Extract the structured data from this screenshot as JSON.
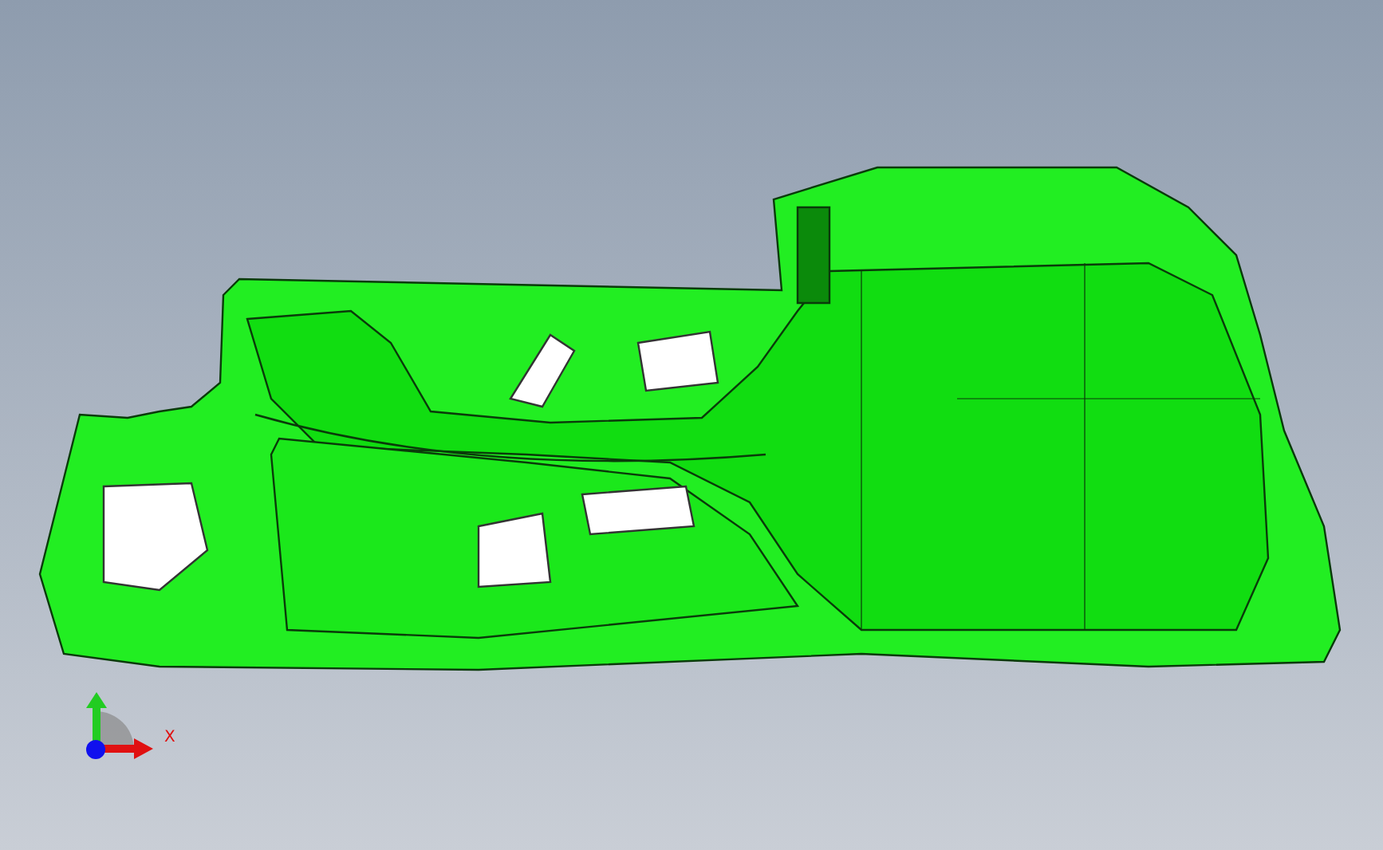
{
  "viewport": {
    "axis_triad": {
      "x_label": "X"
    }
  }
}
